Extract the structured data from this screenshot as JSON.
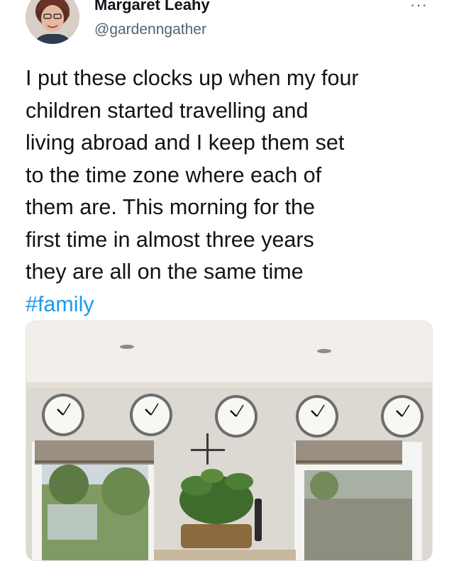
{
  "author": {
    "display_name": "Margaret Leahy",
    "handle": "@gardenngather"
  },
  "menu": {
    "more_label": "···"
  },
  "tweet": {
    "lines": [
      "I put these clocks up when my four",
      "children started travelling and",
      "living abroad and I keep them set",
      "to the time zone where each of",
      "them are.  This morning for the",
      "first time in almost three years",
      "they are all on the same time"
    ],
    "hashtag": "#family"
  },
  "photo": {
    "clock_count": 5
  },
  "colors": {
    "text": "#0f1419",
    "secondary": "#536471",
    "link": "#1d9bf0"
  },
  "icons": [
    "avatar",
    "more-icon"
  ]
}
